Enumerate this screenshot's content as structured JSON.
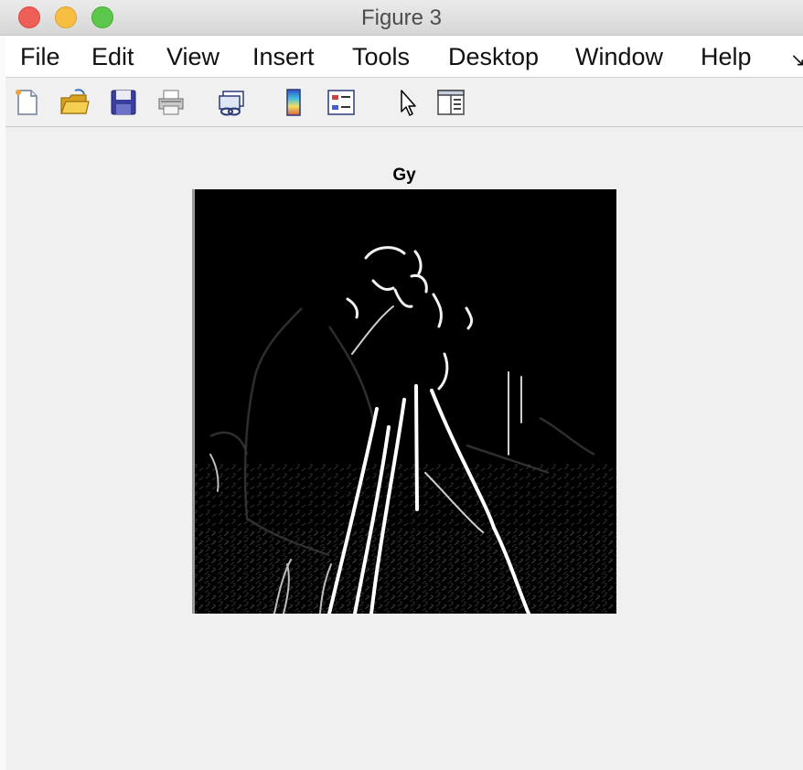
{
  "window": {
    "title": "Figure 3"
  },
  "menu": {
    "items": [
      {
        "label": "File"
      },
      {
        "label": "Edit"
      },
      {
        "label": "View"
      },
      {
        "label": "Insert"
      },
      {
        "label": "Tools"
      },
      {
        "label": "Desktop"
      },
      {
        "label": "Window"
      },
      {
        "label": "Help"
      }
    ]
  },
  "toolbar": {
    "buttons": [
      {
        "icon": "new-figure-icon"
      },
      {
        "icon": "open-file-icon"
      },
      {
        "icon": "save-icon"
      },
      {
        "icon": "print-icon"
      },
      {
        "icon": "link-plot-icon"
      },
      {
        "icon": "insert-colorbar-icon"
      },
      {
        "icon": "insert-legend-icon"
      },
      {
        "icon": "edit-plot-icon"
      },
      {
        "icon": "property-inspector-icon"
      }
    ]
  },
  "axes": {
    "title": "Gy",
    "image": "grayscale vertical-gradient edge magnitude image of a cameraman with tripod"
  },
  "colors": {
    "close": "#ee5f57",
    "minimize": "#f7be41",
    "maximize": "#5cc84b",
    "background": "#f0f0f0"
  }
}
